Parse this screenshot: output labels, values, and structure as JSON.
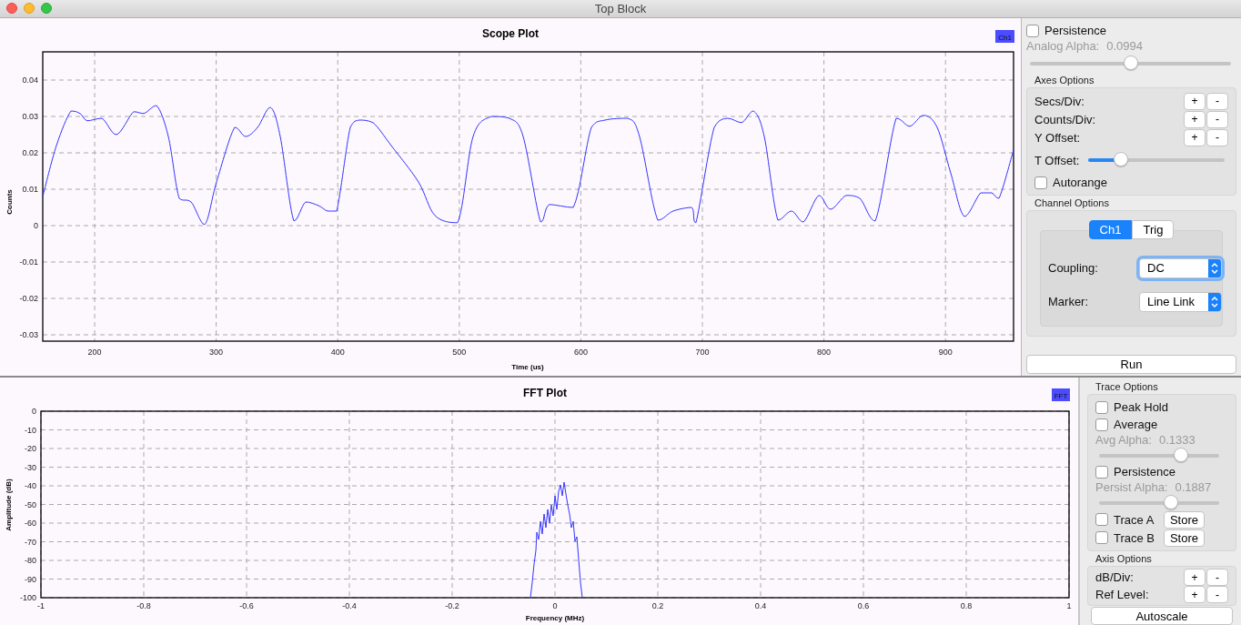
{
  "window": {
    "title": "Top Block"
  },
  "scope_plot": {
    "chart_data": {
      "type": "line",
      "title": "Scope Plot",
      "xlabel": "Time (us)",
      "ylabel": "Counts",
      "x": [
        157.3,
        168.5,
        180.5,
        188.0,
        194.0,
        205.9,
        217.9,
        232.1,
        240.4,
        250.9,
        260.6,
        269.6,
        279.3,
        290.5,
        300.3,
        315.2,
        324.2,
        334.0,
        344.4,
        352.7,
        363.9,
        373.6,
        384.1,
        391.6,
        399.1,
        410.3,
        417.8,
        429.0,
        444.0,
        466.4,
        479.9,
        498.6,
        511.4,
        526.3,
        541.3,
        552.5,
        566.9,
        574.2,
        593.7,
        608.7,
        619.9,
        638.6,
        648.3,
        663.3,
        676.0,
        691.0,
        694.7,
        709.7,
        720.9,
        732.2,
        741.9,
        750.9,
        762.1,
        773.3,
        783.1,
        795.8,
        805.5,
        818.2,
        829.5,
        842.2,
        859.4,
        870.6,
        881.9,
        893.1,
        904.3,
        915.6,
        929.0,
        938.0,
        944.0,
        956.0
      ],
      "grid": true,
      "series": [
        {
          "name": "Ch1",
          "color": "#3535ff",
          "values": [
            0.008,
            0.022,
            0.0315,
            0.0308,
            0.0288,
            0.0295,
            0.025,
            0.0313,
            0.0308,
            0.033,
            0.0245,
            0.0075,
            0.0065,
            0.0003,
            0.012,
            0.027,
            0.0245,
            0.027,
            0.0325,
            0.0245,
            0.0013,
            0.0065,
            0.0055,
            0.004,
            0.004,
            0.027,
            0.029,
            0.0283,
            0.022,
            0.012,
            0.0028,
            0.0008,
            0.0245,
            0.03,
            0.0295,
            0.0245,
            0.001,
            0.0058,
            0.005,
            0.027,
            0.029,
            0.0295,
            0.0245,
            0.0015,
            0.004,
            0.005,
            0.0008,
            0.027,
            0.0295,
            0.0283,
            0.0315,
            0.0245,
            0.0015,
            0.004,
            0.001,
            0.0083,
            0.0045,
            0.0083,
            0.0075,
            0.0013,
            0.0295,
            0.0273,
            0.0303,
            0.027,
            0.0145,
            0.0025,
            0.009,
            0.009,
            0.0075,
            0.0208
          ]
        }
      ],
      "xlim": [
        157.3,
        956
      ],
      "ylim": [
        -0.03175,
        0.04775
      ],
      "xticks": [
        200,
        300,
        400,
        500,
        600,
        700,
        800,
        900
      ],
      "yticks": [
        0.04,
        0.03,
        0.02,
        0.01,
        0,
        -0.01,
        -0.02,
        -0.03
      ]
    }
  },
  "scope_controls": {
    "persistence": {
      "label": "Persistence",
      "checked": false
    },
    "alpha": {
      "label": "Analog Alpha:",
      "value": "0.0994",
      "disabled": true,
      "level": 0.5
    },
    "axes": {
      "title": "Axes Options",
      "steppers": [
        {
          "label": "Secs/Div:",
          "plus": "+",
          "minus": "-"
        },
        {
          "label": "Counts/Div:",
          "plus": "+",
          "minus": "-"
        },
        {
          "label": "Y Offset:",
          "plus": "+",
          "minus": "-"
        }
      ],
      "t_offset": {
        "label": "T Offset:",
        "level": 0.24
      },
      "autorange": {
        "label": "Autorange",
        "checked": false
      }
    },
    "channel": {
      "title": "Channel Options",
      "tabs": [
        {
          "label": "Ch1",
          "selected": true
        },
        {
          "label": "Trig",
          "selected": false
        }
      ],
      "fields": [
        {
          "label": "Coupling:",
          "value": "DC",
          "focused": true
        },
        {
          "label": "Marker:",
          "value": "Line Link",
          "focused": false
        }
      ]
    },
    "run_button": "Run"
  },
  "fft_plot": {
    "title": "FFT Plot",
    "legend": "FFT",
    "ylabel": "Amplitude (dB)",
    "xlabel": "Frequency (MHz)",
    "yticks": [
      "0",
      "-10",
      "-20",
      "-30",
      "-40",
      "-50",
      "-60",
      "-70",
      "-80",
      "-90",
      "-100"
    ],
    "xticks": [
      "-1",
      "-0.8",
      "-0.6",
      "-0.4",
      "-0.2",
      "0",
      "0.2",
      "0.4",
      "0.6",
      "0.8",
      "1"
    ]
  },
  "fft_controls": {
    "trace": {
      "title": "Trace Options",
      "items": [
        {
          "kind": "checkbox",
          "label": "Peak Hold",
          "checked": false
        },
        {
          "kind": "checkbox",
          "label": "Average",
          "checked": false
        },
        {
          "kind": "slider",
          "label": "Avg Alpha:",
          "value": "0.1333",
          "disabled": true,
          "level": 0.68
        },
        {
          "kind": "checkbox",
          "label": "Persistence",
          "checked": false
        },
        {
          "kind": "slider",
          "label": "Persist Alpha:",
          "value": "0.1887",
          "disabled": true,
          "level": 0.6
        },
        {
          "kind": "store",
          "label": "Trace A",
          "checked": false,
          "button": "Store"
        },
        {
          "kind": "store",
          "label": "Trace B",
          "checked": false,
          "button": "Store"
        }
      ]
    },
    "axis": {
      "title": "Axis Options",
      "steppers": [
        {
          "label": "dB/Div:",
          "plus": "+",
          "minus": "-"
        },
        {
          "label": "Ref Level:",
          "plus": "+",
          "minus": "-"
        }
      ]
    },
    "autoscale_button": "Autoscale"
  }
}
